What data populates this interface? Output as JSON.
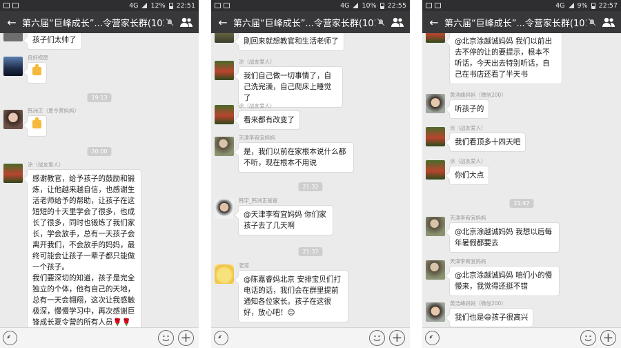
{
  "colors": {
    "titlebar": "#38383b",
    "chat_bg": "#ebebeb",
    "bubble": "#ffffff",
    "time_pill": "#cecece"
  },
  "panels": [
    {
      "status": {
        "signal": "4G",
        "battery": "12%",
        "time": "22:51"
      },
      "title": "第六届“巨峰成长”...令营家长群(101)",
      "timestamps": [
        "19:13",
        "20:00"
      ],
      "messages": [
        {
          "name": "",
          "text": "孩子们太帅了"
        },
        {
          "name": "良好祝愿",
          "text": "👍"
        },
        {
          "name": "韩洲正（夏令营妈妈）",
          "text": "👍"
        },
        {
          "name": "涂（战友爱人）",
          "text": "感谢教官，给予孩子的鼓励和锻炼，让他越来越自信，也感谢生活老师给予的帮助，让孩子在这短短的十天里学会了很多，也成长了很多，同时也锻炼了我们家长，学会放手，总有一天孩子会离开我们，不会放手的妈妈，最终可能会让孩子一辈子都只能做一个孩子。\n我们要深切的知道，孩子是完全独立的个体，他有自己的天地，总有一天会翱翔，这次让我感触极深，慢慢学习中，再次感谢巨锋成长夏令营的所有人员🌹🌹\n🌹🌹🌹"
        }
      ]
    },
    {
      "status": {
        "signal": "4G",
        "battery": "10%",
        "time": "22:55"
      },
      "title": "第六届“巨峰成长”...令营家长群(101)",
      "timestamps": [
        "21:32",
        "21:37"
      ],
      "messages": [
        {
          "name": "",
          "text": "刚回来就想教官和生活老师了"
        },
        {
          "name": "涂（战友爱人）",
          "text": "我们自己做一切事情了，自己洗完澡，自己爬床上睡觉了"
        },
        {
          "name": "涂（战友爱人）",
          "text": "看来都有改变了"
        },
        {
          "name": "天津李宥宜妈妈",
          "text": "是，我们以前在家根本说什么都不听，现在根本不用说"
        },
        {
          "name": "韩宇_韩洲正爸爸",
          "text": "@天津李宥宜妈妈 你们家孩子去了几天啊"
        },
        {
          "name": "老道",
          "text": "@陈嘉睿妈北京 安排宝贝们打电话的话，我们会在群里提前通知各位家长。孩子在这很好，放心吧！😊"
        }
      ]
    },
    {
      "status": {
        "signal": "4G",
        "battery": "9%",
        "time": "22:57"
      },
      "title": "第六届“巨峰成长”...令营家长群(101)",
      "timestamps": [
        "21:47"
      ],
      "messages": [
        {
          "name": "",
          "text": "@北京涂越诚妈妈 我们以前出去不停的让的要提示，根本不听话，今天出去特别听话，自己在书店还看了半天书"
        },
        {
          "name": "黄浩峰妈妈（微信200）",
          "text": "听孩子的"
        },
        {
          "name": "涂（战友爱人）",
          "text": "我们看顶多十四天吧"
        },
        {
          "name": "涂（战友爱人）",
          "text": "你们大点"
        },
        {
          "name": "天津李宥宜妈妈",
          "text": "@北京涂越诚妈妈 我想以后每年暑假都要去"
        },
        {
          "name": "天津李宥宜妈妈",
          "text": "@北京涂越诚妈妈 咱们小的慢慢来，我觉得还挺不错"
        },
        {
          "name": "黄浩峰妈妈（微信200）",
          "text": "我们也是😄孩子很高兴"
        }
      ]
    }
  ]
}
